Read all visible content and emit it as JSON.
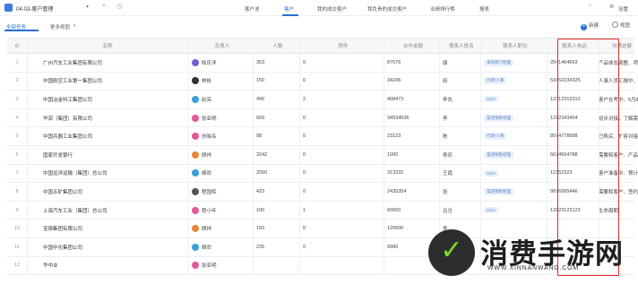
{
  "app": {
    "title": "04-03-客户管理"
  },
  "nav": {
    "tabs": [
      {
        "label": "客户池"
      },
      {
        "label": "客户"
      },
      {
        "label": "我的成交客户"
      },
      {
        "label": "我负责的成交客户"
      },
      {
        "label": "业绩排行榜"
      },
      {
        "label": "报表"
      }
    ],
    "settings_label": "设置"
  },
  "views": {
    "tabs": [
      {
        "label": "全部任务"
      },
      {
        "label": "更多视图"
      }
    ],
    "new_label": "新建",
    "view_label": "视图"
  },
  "table": {
    "columns": [
      "名称",
      "负责人",
      "人数",
      "附件",
      "合作金额",
      "联系人姓名",
      "联系人职位",
      "联系人电话",
      "沟通进展"
    ],
    "rows": [
      {
        "idx": "1",
        "name": "广州汽车工业集团有限公司",
        "owner": "陆庆洋",
        "owner_color": "#7a5ad6",
        "people": "353",
        "attach": "0",
        "amount": "87675",
        "contact": "康",
        "job": "采购部门经理",
        "phone": "2541464563",
        "progress": "产品体验调整、项目细"
      },
      {
        "idx": "2",
        "name": "中国航空工业第一集团公司",
        "owner": "林彬",
        "owner_color": "#333333",
        "people": "150",
        "attach": "0",
        "amount": "34245",
        "contact": "田",
        "job": "行政/人事",
        "phone": "53452234325",
        "progress": "人事人员汇报中、等待"
      },
      {
        "idx": "3",
        "name": "中国冶金科工集团公司",
        "owner": "赵亮",
        "owner_color": "#3aa0d8",
        "people": "490",
        "attach": "2",
        "amount": "408473",
        "contact": "李兆",
        "job": "CEO",
        "phone": "12312312312",
        "progress": "客户在考中、5月8日"
      },
      {
        "idx": "4",
        "name": "华润（集团）有限公司",
        "owner": "张亚明",
        "owner_color": "#e05a9a",
        "people": "609",
        "attach": "0",
        "amount": "34534536",
        "contact": "李",
        "job": "渠道销售经理",
        "phone": "1212343454",
        "progress": "初步对接，了解需求"
      },
      {
        "idx": "5",
        "name": "中国兵器工业集团公司",
        "owner": "刘晓名",
        "owner_color": "#e05a9a",
        "people": "98",
        "attach": "0",
        "amount": "23123",
        "contact": "陈",
        "job": "行政/人事",
        "phone": "8974778998",
        "progress": "已购买、扩容对接了"
      },
      {
        "idx": "6",
        "name": "国家开发银行",
        "owner": "顾祥",
        "owner_color": "#e8853a",
        "people": "3242",
        "attach": "0",
        "amount": "1000",
        "contact": "佟庆",
        "job": "渠道销售经理",
        "phone": "5674564788",
        "progress": "需要和客户、产品演"
      },
      {
        "idx": "7",
        "name": "中国远洋运输（集团）总公司",
        "owner": "柳欢",
        "owner_color": "#3aa0d8",
        "people": "2050",
        "attach": "0",
        "amount": "313332",
        "contact": "王霞",
        "job": "CEO",
        "phone": "12352323",
        "progress": "客户准备中、预计8"
      },
      {
        "idx": "8",
        "name": "中国五矿集团公司",
        "owner": "程国晖",
        "owner_color": "#555555",
        "people": "423",
        "attach": "0",
        "amount": "2435354",
        "contact": "张",
        "job": "渠道销售经理",
        "phone": "9876995446",
        "progress": "需要和客户、签约"
      },
      {
        "idx": "9",
        "name": "上海汽车工业（集团）总公司",
        "owner": "程小年",
        "owner_color": "#e05a9a",
        "people": "100",
        "attach": "1",
        "amount": "60000",
        "contact": "吕旦",
        "job": "CEO",
        "phone": "13123123123",
        "progress": "生命周期"
      },
      {
        "idx": "10",
        "name": "宝钢集团有限公司",
        "owner": "顾祥",
        "owner_color": "#e8853a",
        "people": "150",
        "attach": "0",
        "amount": "120000",
        "contact": "李",
        "job": "",
        "phone": "",
        "progress": ""
      },
      {
        "idx": "11",
        "name": "中国中化集团公司",
        "owner": "柳欢",
        "owner_color": "#3aa0d8",
        "people": "235",
        "attach": "0",
        "amount": "9980",
        "contact": "石图",
        "job": "",
        "phone": "",
        "progress": ""
      },
      {
        "idx": "12",
        "name": "华中业",
        "owner": "张亚明",
        "owner_color": "#e05a9a",
        "people": "",
        "attach": "",
        "amount": "",
        "contact": "",
        "job": "",
        "phone": "",
        "progress": ""
      }
    ]
  },
  "colors": {
    "accent": "#2e6fd1",
    "highlight": "#e02b2b"
  },
  "watermark": {
    "title": "消费手游网",
    "url": "WWW.XINNANWANG.COM"
  }
}
